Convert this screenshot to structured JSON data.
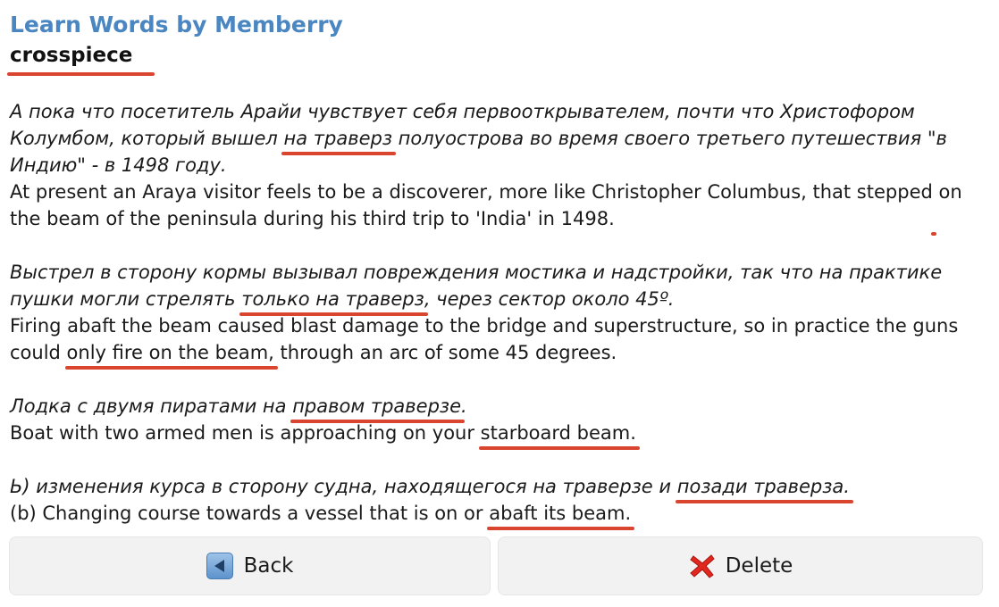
{
  "app_title": "Learn Words by Memberry",
  "word": "crosspiece",
  "colors": {
    "title_blue": "#4a86c1",
    "highlight_red": "#d9452f",
    "button_bg": "#f2f2f2"
  },
  "examples": [
    {
      "ru": {
        "before": "А пока что посетитель Арайи чувствует себя первооткрывателем, почти что Христофором Колумбом, который вышел ",
        "highlight": "на траверз",
        "after": " полуострова во время своего третьего путешествия \"в Индию\" - в 1498 году."
      },
      "en": {
        "before": "At present an Araya visitor feels to be a discoverer, more like Christopher Columbus, that stepped",
        "highlight": " on the beam ",
        "after": "of the peninsula during his third trip to 'India' in 1498."
      }
    },
    {
      "ru": {
        "before": "Выстрел в сторону кормы вызывал повреждения мостика и надстройки, так что на практике пушки могли стрелять ",
        "highlight": "только на траверз",
        "after": ", через сектор около 45º."
      },
      "en": {
        "before": "Firing abaft the beam caused blast damage to the bridge and superstructure, so in practice the guns could ",
        "highlight": "only fire on the beam,",
        "after": " through an arc of some 45 degrees."
      }
    },
    {
      "ru": {
        "before": "Лодка с двумя пиратами на ",
        "highlight": "правом траверзе",
        "after": "."
      },
      "en": {
        "before": "Boat with two armed men is approaching on your ",
        "highlight": "starboard beam.",
        "after": ""
      }
    },
    {
      "ru": {
        "before": "Ь) изменения курса в сторону судна, находящегося на траверзе и ",
        "highlight": "позади траверза.",
        "after": ""
      },
      "en": {
        "before": "(b) Changing course towards a vessel that is on or ",
        "highlight": "abaft its beam.",
        "after": ""
      }
    }
  ],
  "buttons": {
    "back": {
      "label": "Back",
      "icon": "back-arrow-icon"
    },
    "delete": {
      "label": "Delete",
      "icon": "red-x-icon"
    }
  }
}
